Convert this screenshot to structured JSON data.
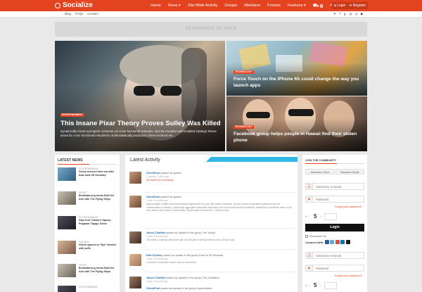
{
  "site": {
    "name": "Socialize"
  },
  "nav": {
    "items": [
      "Home",
      "News ▾",
      "Site-Wide Activity",
      "Groups",
      "Members",
      "Forums",
      "Features ▾"
    ],
    "cart_count": "0",
    "login": "Login",
    "register": "Register"
  },
  "subnav": {
    "links": [
      "Blog",
      "FAQs",
      "Contact"
    ]
  },
  "ad": {
    "label": "RESPONSIVE AD AREA"
  },
  "hero": {
    "main": {
      "tag": "ENTERTAINMENT",
      "title": "This Insane Pixar Theory Proves Sulley Was Killed",
      "excerpt": "Dynamically brand synergistic schemas via cross functional networks. Quickly visualize web-enabled strategic theme areas for cross functional e-business. Enthusiastically productize client-centered we..."
    },
    "top_right": {
      "tag": "TECHNOLOGY",
      "title": "Force Touch on the iPhone 6S could change the way you launch apps"
    },
    "bottom_right": {
      "tag": "TECHNOLOGY",
      "title": "Facebook group helps people in Hawaii find their stolen phone"
    }
  },
  "latest_news": {
    "title": "LATEST NEWS",
    "items": [
      {
        "category": "ENTERTAINMENT",
        "title": "Group rescued from sea after boat sails off Gunwarp"
      },
      {
        "category": "SPORT",
        "title": "Breakdancing meets Butt Det Arm with The Flying Steps"
      },
      {
        "category": "ENTERTAINMENT",
        "title": "Hear Kurt Cobain's Sparse, Poignant 'Sappy' Demo"
      },
      {
        "category": "FASHION",
        "title": "Gisele spaced on 'Bye' Gordon' with yuffs"
      },
      {
        "category": "SPORT",
        "title": "Breakdancing meets Butt Det Arm with The Flying Steps"
      },
      {
        "category": "ENTERTAINMENT",
        "title": "Hear Kurt Cobain's Sparse Poignant Demo"
      }
    ]
  },
  "activity": {
    "title": "Latest Activity",
    "items": [
      {
        "user": "GhostPool",
        "action": "posted an update",
        "time": "2 months, 1 week ago",
        "body": "@GhostPool It's amazing."
      },
      {
        "user": "GhostPool",
        "action": "posted an update",
        "time": "1 year, 5 months ago",
        "body": "Appropriately enable both economically alignments vis-à-vis fully tested expertise. Quickly brand cooperative quality vectors for maintainable e-markets. Continually aggregate enterprise information vis-à-vis functional functionalities. Assertively coordinate state of the art e-tailers with holistic communities. Dynamically underwhelm... [Read more]"
      },
      {
        "user": "Jason Chaffetz",
        "action": "posted an update in the group The Tourist",
        "time": "1 year, 5 months ago",
        "body": "The artist is nothing without the gift, but the gift is nothing without work. (Emile Zola)"
      },
      {
        "user": "Dan Corless",
        "action": "posted an update in the group Gone in 60 Seconds",
        "time": "1 year, 5 months ago",
        "body": "It is better to deserve honors than to have them."
      },
      {
        "user": "Jason Chaffetz",
        "action": "posted an update in the group The Godfather",
        "time": "1 year, 5 months ago",
        "body": ""
      },
      {
        "user": "GhostPool",
        "action": "posted an update in the group Supervillains",
        "time": "",
        "body": ""
      }
    ]
  },
  "join": {
    "title": "JOIN THE COMMUNITY",
    "tabs": [
      "Username Send",
      "Password Sends"
    ],
    "username_placeholder": "Username or Email",
    "password_placeholder": "Password",
    "captcha_op": "8 +",
    "captcha_num": "5",
    "captcha_eq": "=",
    "forgot": "Forgot your password?",
    "login_button": "Login",
    "remember": "Remember me",
    "connect": "Connect with:"
  },
  "colors": {
    "brand": "#e4431f",
    "accent": "#2fb8e6"
  }
}
